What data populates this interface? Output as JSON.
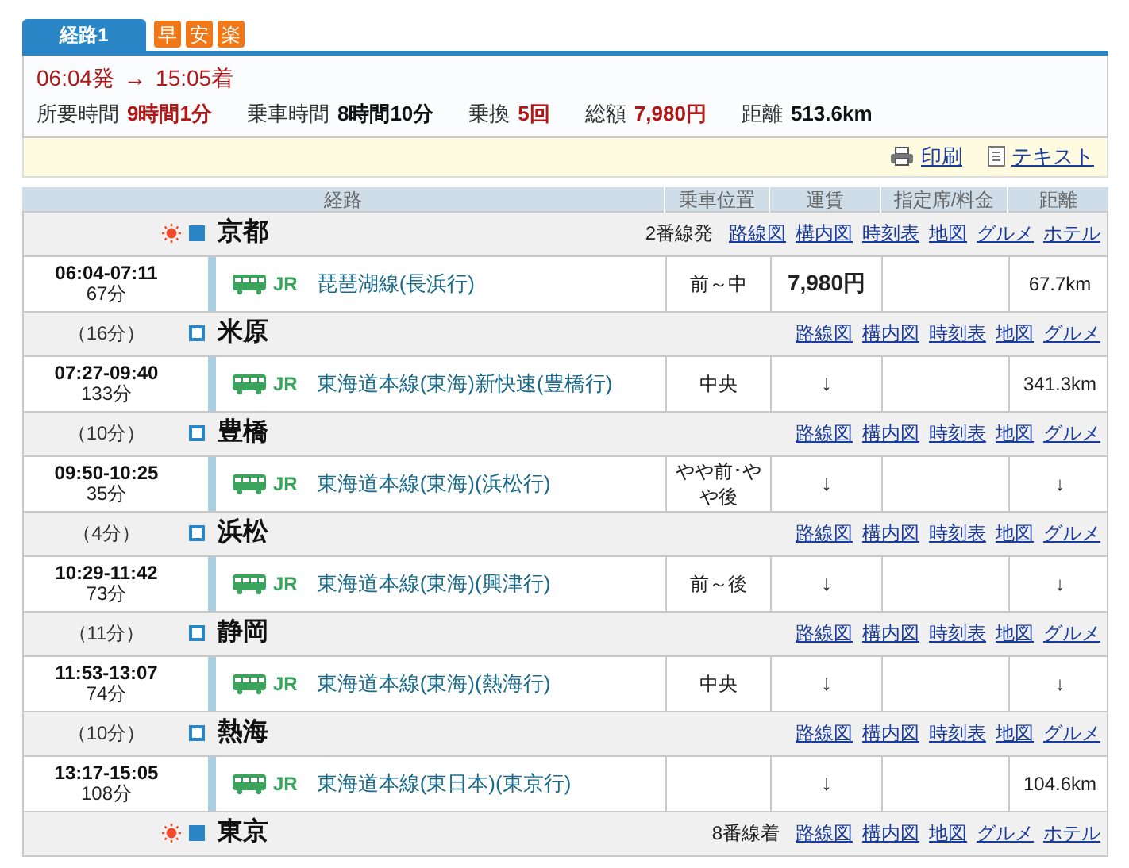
{
  "tabs": [
    {
      "label": "経路1",
      "selected": true
    }
  ],
  "badges": [
    "早",
    "安",
    "楽"
  ],
  "summary": {
    "departure": "06:04発",
    "arrow": "→",
    "arrival": "15:05着",
    "stats": [
      {
        "label": "所要時間",
        "value": "9時間1分",
        "highlight": true
      },
      {
        "label": "乗車時間",
        "value": "8時間10分",
        "highlight": false
      },
      {
        "label": "乗換",
        "value": "5回",
        "highlight": true
      },
      {
        "label": "総額",
        "value": "7,980円",
        "highlight": true
      },
      {
        "label": "距離",
        "value": "513.6km",
        "highlight": false
      }
    ]
  },
  "toolbar": [
    {
      "kind": "print",
      "label": "印刷"
    },
    {
      "kind": "text",
      "label": "テキスト"
    }
  ],
  "columns": [
    "経路",
    "乗車位置",
    "運賃",
    "指定席/料金",
    "距離"
  ],
  "rows": [
    {
      "kind": "station",
      "endpoint": true,
      "name": "京都",
      "platform": "2番線発",
      "links": [
        "路線図",
        "構内図",
        "時刻表",
        "地図",
        "グルメ",
        "ホテル"
      ]
    },
    {
      "kind": "segment",
      "time": "06:04-07:11",
      "duration": "67分",
      "operator": "JR",
      "line": "琵琶湖線(長浜行)",
      "position": "前～中",
      "fare": "7,980円",
      "distance": "67.7km"
    },
    {
      "kind": "station",
      "endpoint": false,
      "wait": "（16分）",
      "name": "米原",
      "links": [
        "路線図",
        "構内図",
        "時刻表",
        "地図",
        "グルメ"
      ]
    },
    {
      "kind": "segment",
      "time": "07:27-09:40",
      "duration": "133分",
      "operator": "JR",
      "line": "東海道本線(東海)新快速(豊橋行)",
      "position": "中央",
      "fare": "↓",
      "distance": "341.3km"
    },
    {
      "kind": "station",
      "endpoint": false,
      "wait": "（10分）",
      "name": "豊橋",
      "links": [
        "路線図",
        "構内図",
        "時刻表",
        "地図",
        "グルメ"
      ]
    },
    {
      "kind": "segment",
      "time": "09:50-10:25",
      "duration": "35分",
      "operator": "JR",
      "line": "東海道本線(東海)(浜松行)",
      "position": "やや前･やや後",
      "fare": "↓",
      "distance": "↓"
    },
    {
      "kind": "station",
      "endpoint": false,
      "wait": "（4分）",
      "name": "浜松",
      "links": [
        "路線図",
        "構内図",
        "時刻表",
        "地図",
        "グルメ"
      ]
    },
    {
      "kind": "segment",
      "time": "10:29-11:42",
      "duration": "73分",
      "operator": "JR",
      "line": "東海道本線(東海)(興津行)",
      "position": "前～後",
      "fare": "↓",
      "distance": "↓"
    },
    {
      "kind": "station",
      "endpoint": false,
      "wait": "（11分）",
      "name": "静岡",
      "links": [
        "路線図",
        "構内図",
        "時刻表",
        "地図",
        "グルメ"
      ]
    },
    {
      "kind": "segment",
      "time": "11:53-13:07",
      "duration": "74分",
      "operator": "JR",
      "line": "東海道本線(東海)(熱海行)",
      "position": "中央",
      "fare": "↓",
      "distance": "↓"
    },
    {
      "kind": "station",
      "endpoint": false,
      "wait": "（10分）",
      "name": "熱海",
      "links": [
        "路線図",
        "構内図",
        "時刻表",
        "地図",
        "グルメ"
      ]
    },
    {
      "kind": "segment",
      "time": "13:17-15:05",
      "duration": "108分",
      "operator": "JR",
      "line": "東海道本線(東日本)(東京行)",
      "fare": "↓",
      "distance": "104.6km"
    },
    {
      "kind": "station",
      "endpoint": true,
      "name": "東京",
      "platform": "8番線着",
      "links": [
        "路線図",
        "構内図",
        "地図",
        "グルメ",
        "ホテル"
      ]
    }
  ]
}
